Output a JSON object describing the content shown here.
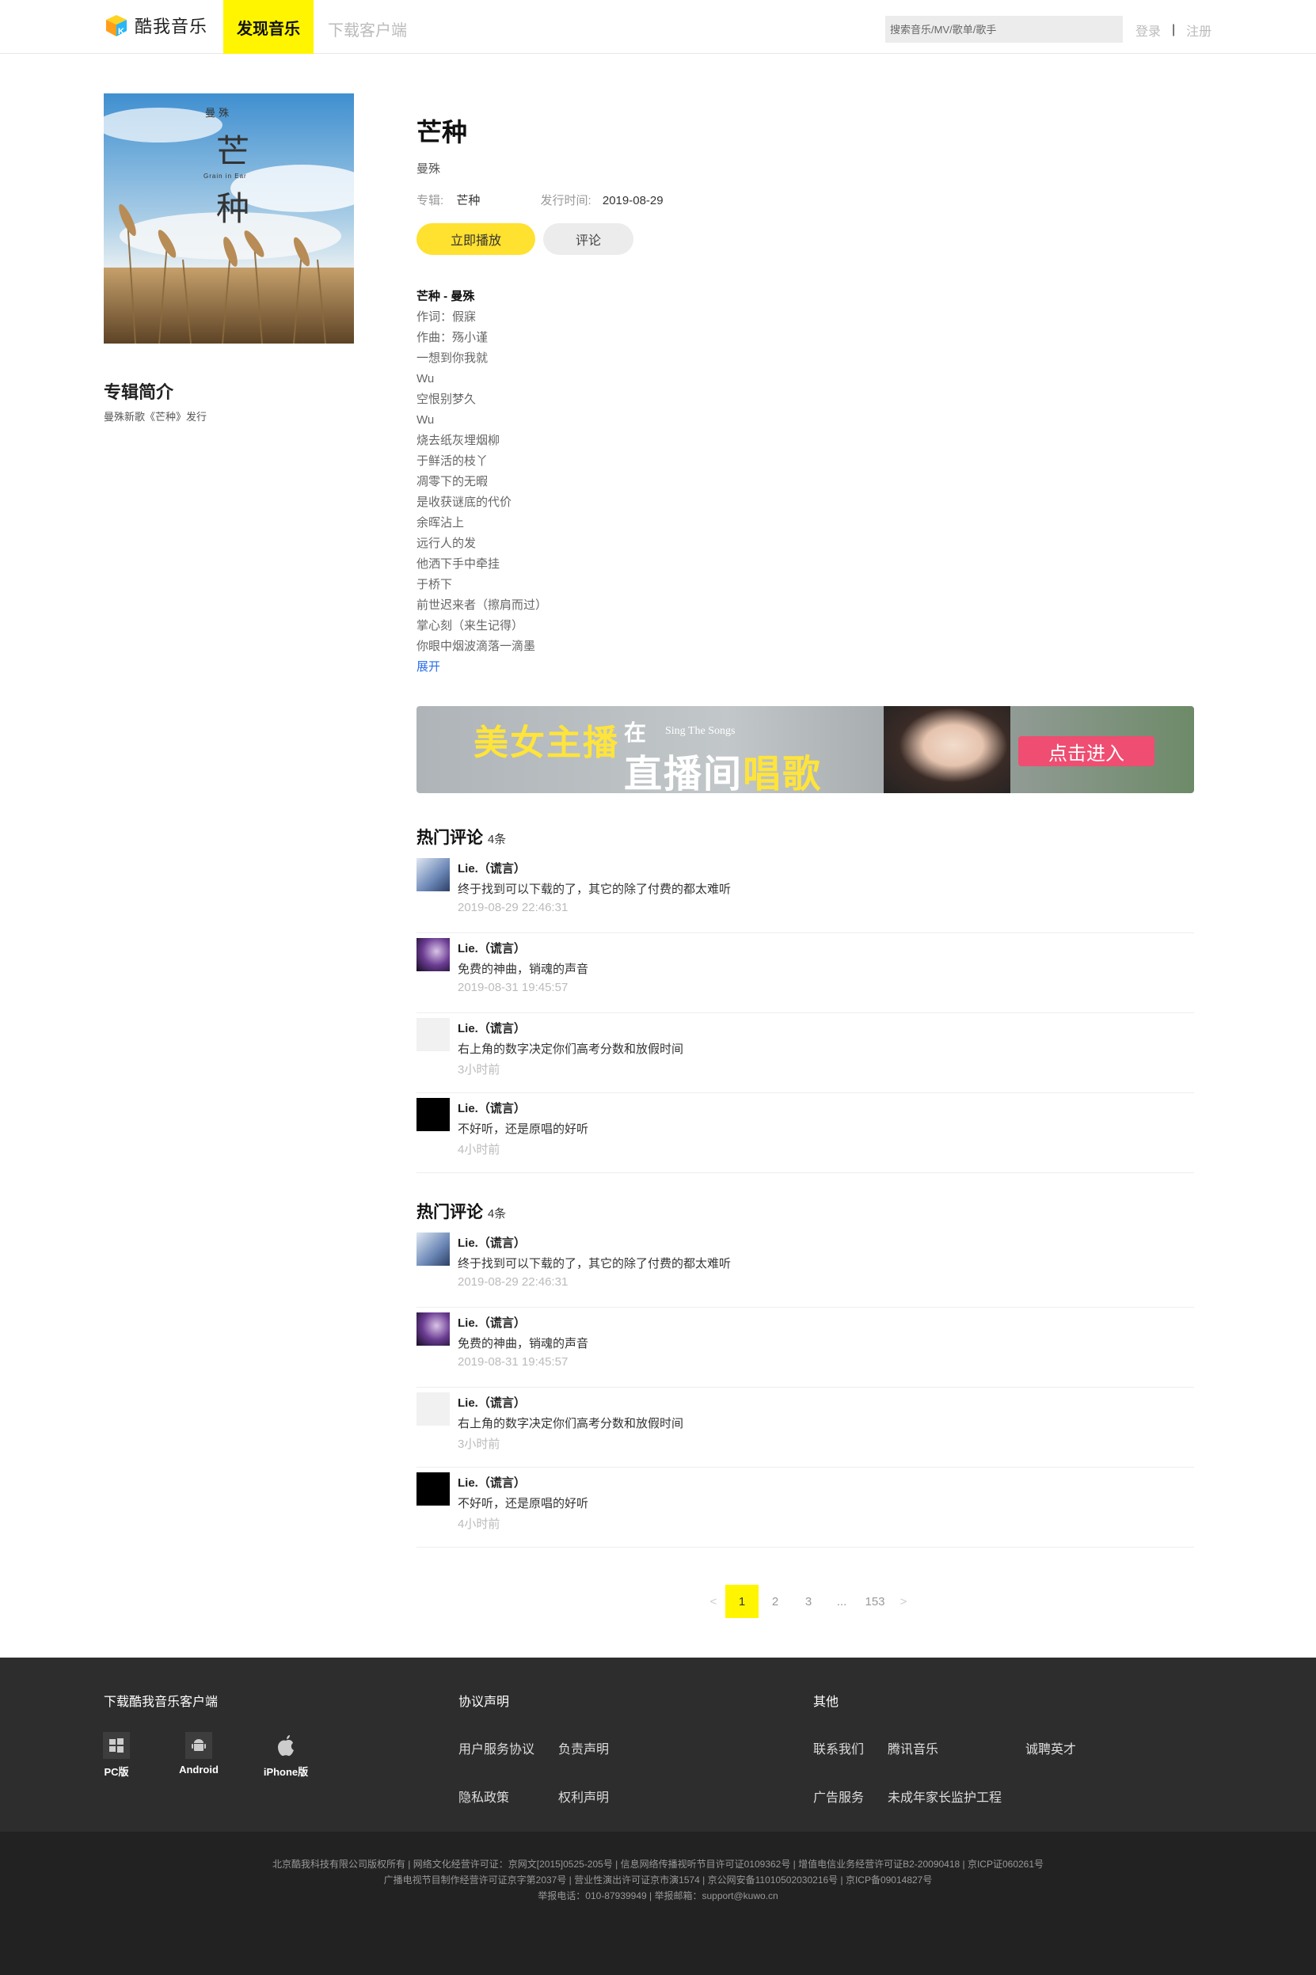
{
  "header": {
    "logo_text": "酷我音乐",
    "nav_active": "发现音乐",
    "nav_download": "下载客户端",
    "search_placeholder": "搜索音乐/MV/歌单/歌手",
    "login": "登录",
    "separator": "|",
    "register": "注册"
  },
  "album": {
    "cover_top_text": "曼 殊",
    "cover_char1": "芒",
    "cover_char2": "种",
    "cover_en": "Grain in Ear",
    "intro_title": "专辑简介",
    "intro_text": "曼殊新歌《芒种》发行"
  },
  "song": {
    "title": "芒种",
    "artist": "曼殊",
    "album_label": "专辑:",
    "album_value": "芒种",
    "release_label": "发行时间:",
    "release_value": "2019-08-29",
    "play_button": "立即播放",
    "comment_button": "评论"
  },
  "lyrics": {
    "head": "芒种 - 曼殊",
    "lines": [
      "作词：假寐",
      "作曲：殇小谨",
      "一想到你我就",
      "Wu",
      "空恨别梦久",
      "Wu",
      "烧去纸灰埋烟柳",
      "于鲜活的枝丫",
      "凋零下的无暇",
      "是收获谜底的代价",
      "余晖沾上",
      "远行人的发",
      "他洒下手中牵挂",
      "于桥下",
      "前世迟来者（擦肩而过）",
      "掌心刻（来生记得）",
      "你眼中烟波滴落一滴墨"
    ],
    "expand": "展开"
  },
  "banner": {
    "line1": "美女主播",
    "line2": "在",
    "line3a": "直播间",
    "line3b": "唱歌",
    "english": "Sing The Songs",
    "cta": "点击进入"
  },
  "comment_sections": [
    {
      "title": "热门评论",
      "count": "4条",
      "items": [
        {
          "name": "Lie.（谎言）",
          "text": "终于找到可以下载的了，其它的除了付费的都太难听",
          "time": "2019-08-29 22:46:31"
        },
        {
          "name": "Lie.（谎言）",
          "text": "免费的神曲，销魂的声音",
          "time": "2019-08-31 19:45:57"
        },
        {
          "name": "Lie.（谎言）",
          "text": "右上角的数字决定你们高考分数和放假时间",
          "time": "3小时前"
        },
        {
          "name": "Lie.（谎言）",
          "text": "不好听，还是原唱的好听",
          "time": "4小时前"
        }
      ]
    },
    {
      "title": "热门评论",
      "count": "4条",
      "items": [
        {
          "name": "Lie.（谎言）",
          "text": "终于找到可以下载的了，其它的除了付费的都太难听",
          "time": "2019-08-29 22:46:31"
        },
        {
          "name": "Lie.（谎言）",
          "text": "免费的神曲，销魂的声音",
          "time": "2019-08-31 19:45:57"
        },
        {
          "name": "Lie.（谎言）",
          "text": "右上角的数字决定你们高考分数和放假时间",
          "time": "3小时前"
        },
        {
          "name": "Lie.（谎言）",
          "text": "不好听，还是原唱的好听",
          "time": "4小时前"
        }
      ]
    }
  ],
  "pagination": {
    "prev": "<",
    "pages": [
      "1",
      "2",
      "3",
      "...",
      "153"
    ],
    "next": ">",
    "current": "1"
  },
  "footer": {
    "download_title": "下载酷我音乐客户端",
    "pc": "PC版",
    "android": "Android",
    "iphone": "iPhone版",
    "protocol_title": "协议声明",
    "user_agreement": "用户服务协议",
    "disclaimer": "负责声明",
    "privacy": "隐私政策",
    "rights": "权利声明",
    "other_title": "其他",
    "contact": "联系我们",
    "tencent": "腾讯音乐",
    "jobs": "诚聘英才",
    "ads": "广告服务",
    "minor": "未成年家长监护工程",
    "legal_line1": "北京酷我科技有限公司版权所有 | 网络文化经营许可证：京网文[2015]0525-205号 | 信息网络传播视听节目许可证0109362号 | 增值电信业务经营许可证B2-20090418 | 京ICP证060261号",
    "legal_line2": "广播电视节目制作经营许可证京字第2037号 | 营业性演出许可证京市演1574 | 京公网安备11010502030216号 | 京ICP备09014827号",
    "legal_line3": "举报电话：010-87939949 | 举报邮箱：support@kuwo.cn"
  },
  "colors": {
    "accent_yellow": "#fff500",
    "play_button": "#ffe12f",
    "link_blue": "#2b6de8",
    "footer_dark": "#2d2d2d",
    "footer_darker": "#222222"
  }
}
